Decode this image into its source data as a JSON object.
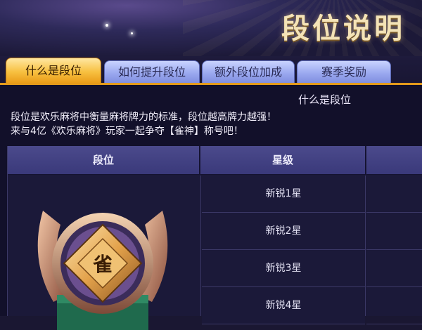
{
  "header": {
    "title": "段位说明"
  },
  "tabs": [
    {
      "label": "什么是段位",
      "active": true
    },
    {
      "label": "如何提升段位",
      "active": false
    },
    {
      "label": "额外段位加成",
      "active": false
    },
    {
      "label": "赛季奖励",
      "active": false
    }
  ],
  "content": {
    "subheading": "什么是段位",
    "intro_line1": "段位是欢乐麻将中衡量麻将牌力的标准，段位越高牌力越强！",
    "intro_line2": "来与4亿《欢乐麻将》玩家一起争夺【雀神】称号吧！"
  },
  "table": {
    "headers": [
      "段位",
      "星级",
      ""
    ],
    "stars": [
      "新锐1星",
      "新锐2星",
      "新锐3星",
      "新锐4星"
    ],
    "emblem_glyph": "雀"
  },
  "colors": {
    "accent": "#f7bf3f",
    "tab_inactive": "#9aa8ef",
    "header_bg": "#4b4a8c",
    "content_bg": "#12102a"
  },
  "icons": {
    "emblem": "rank-emblem-icon"
  }
}
